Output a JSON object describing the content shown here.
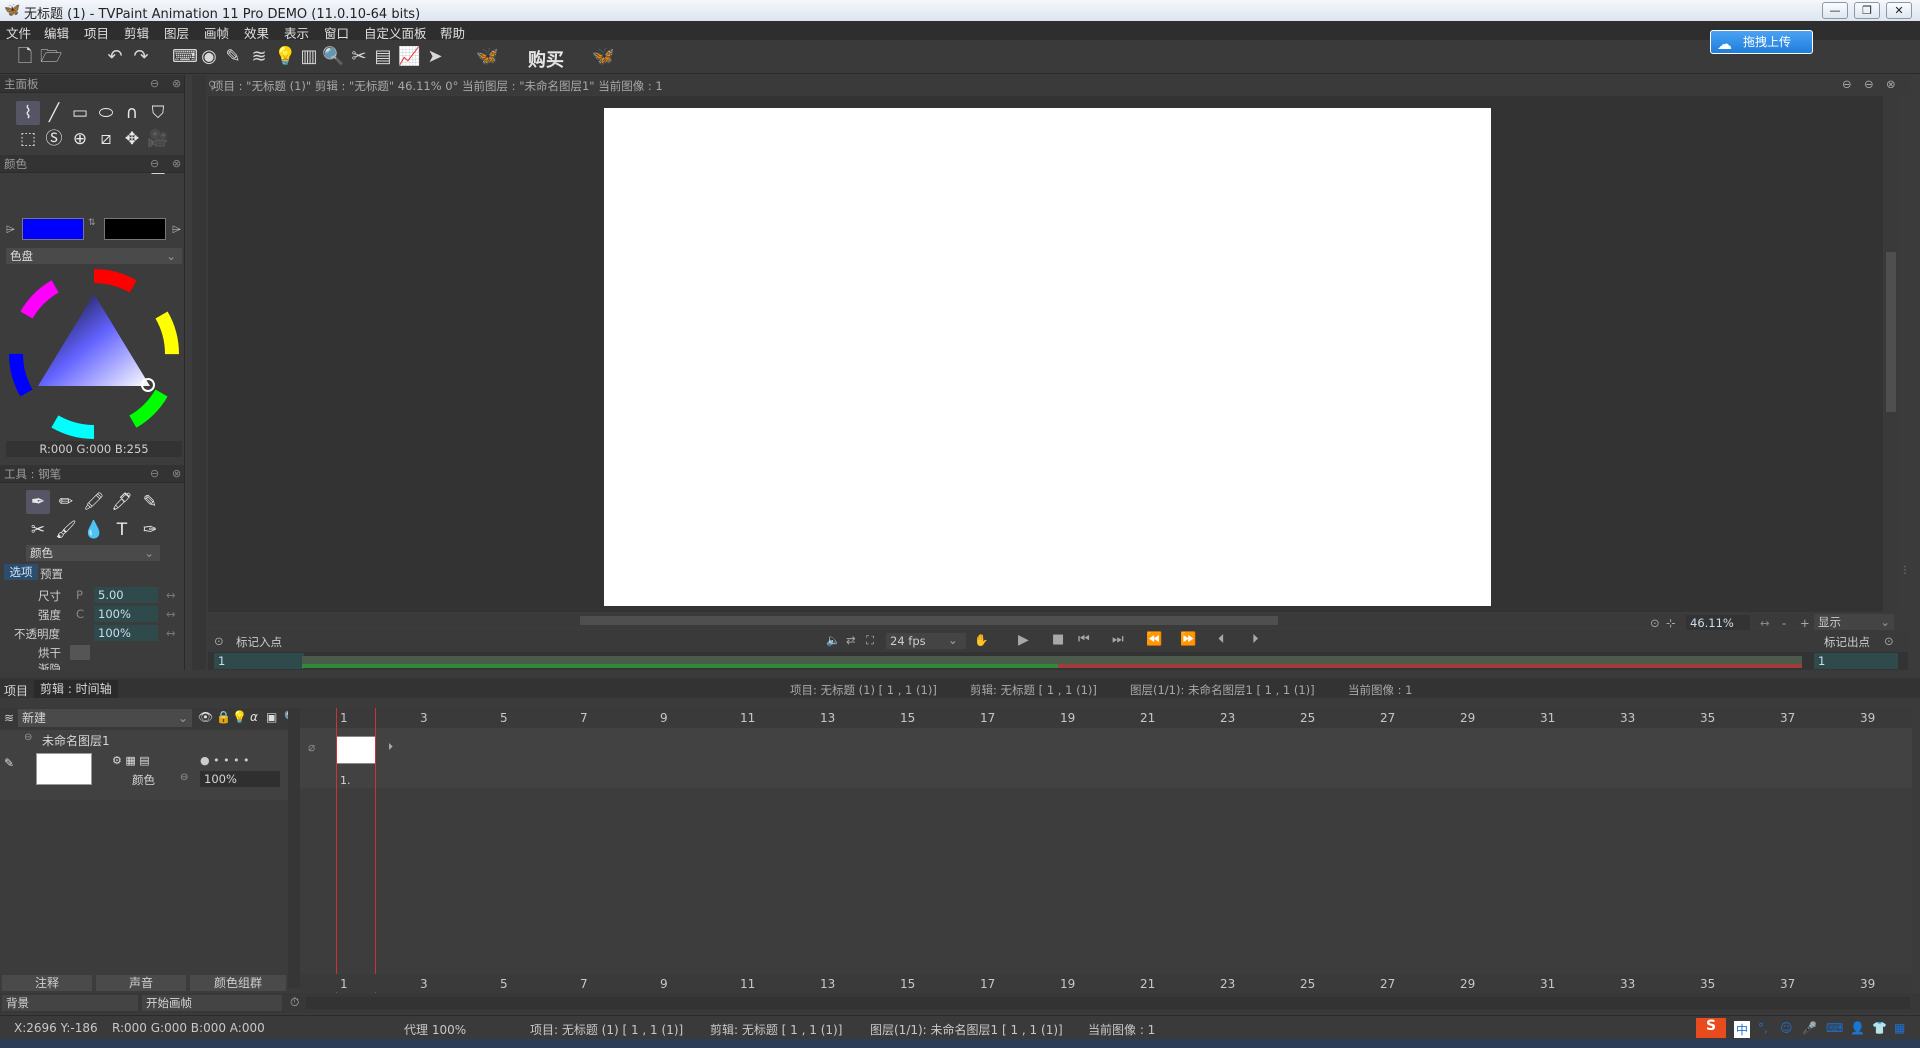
{
  "window": {
    "title": "无标题 (1) - TVPaint Animation 11 Pro DEMO (11.0.10-64 bits)",
    "buttons": [
      "—",
      "❐",
      "✕"
    ]
  },
  "menu": [
    "文件",
    "编辑",
    "项目",
    "剪辑",
    "图层",
    "画帧",
    "效果",
    "表示",
    "窗口",
    "自定义面板",
    "帮助"
  ],
  "toolbar": {
    "buy_label": "购买",
    "upload_label": "拖拽上传"
  },
  "main_panel": {
    "title": "主面板"
  },
  "color_panel": {
    "title": "颜色",
    "primary_color": "#0000ff",
    "secondary_color": "#000000",
    "mode_label": "色盘",
    "readout": "R:000 G:000 B:255"
  },
  "tool_panel": {
    "title": "工具 : 钢笔",
    "color_label": "颜色",
    "tabs": [
      "选项",
      "预置"
    ],
    "fields": [
      {
        "label": "尺寸",
        "prefix": "P",
        "value": "5.00"
      },
      {
        "label": "强度",
        "prefix": "C",
        "value": "100%"
      },
      {
        "label": "不透明度",
        "prefix": "",
        "value": "100%"
      },
      {
        "label": "烘干",
        "prefix": "",
        "value": ""
      },
      {
        "label": "渐隐",
        "prefix": "",
        "value": ""
      }
    ]
  },
  "viewport": {
    "info": "项目 : \"无标题 (1)\" 剪辑 : \"无标题\"  46.11%  0°  当前图层 : \"未命名图层1\" 当前图像 : 1",
    "mark_in_label": "标记入点",
    "mark_out_label": "标记出点",
    "fps": "24 fps",
    "zoom": "46.11%",
    "display_label": "显示",
    "frame_in": "1",
    "frame_out": "1"
  },
  "timeline": {
    "tabs": [
      "项目",
      "剪辑 : 时间轴"
    ],
    "info_project": "项目: 无标题 (1) [ 1 , 1  (1)]",
    "info_clip": "剪辑: 无标题 [ 1 , 1  (1)]",
    "info_layer": "图层(1/1): 未命名图层1 [ 1 , 1  (1)]",
    "info_image": "当前图像 : 1",
    "new_label": "新建",
    "layer_name": "未命名图层1",
    "layer_color_label": "颜色",
    "layer_opacity": "100%",
    "frame_label": "1.",
    "frame_numbers": [
      "1",
      "3",
      "5",
      "7",
      "9",
      "11",
      "13",
      "15",
      "17",
      "19",
      "21",
      "23",
      "25",
      "27",
      "29",
      "31",
      "33",
      "35",
      "37",
      "39"
    ],
    "bottom_buttons": [
      "注释",
      "声音",
      "颜色组群"
    ],
    "background_label": "背景",
    "start_frame_label": "开始画帧"
  },
  "status": {
    "coords": "X:2696  Y:-186",
    "color": "R:000 G:000 B:000 A:000",
    "proxy": "代理 100%",
    "project": "项目: 无标题 (1) [ 1 , 1  (1)]",
    "clip": "剪辑: 无标题 [ 1 , 1  (1)]",
    "layer": "图层(1/1): 未命名图层1 [ 1 , 1  (1)]",
    "image": "当前图像 : 1"
  },
  "ime": {
    "label": "中"
  }
}
